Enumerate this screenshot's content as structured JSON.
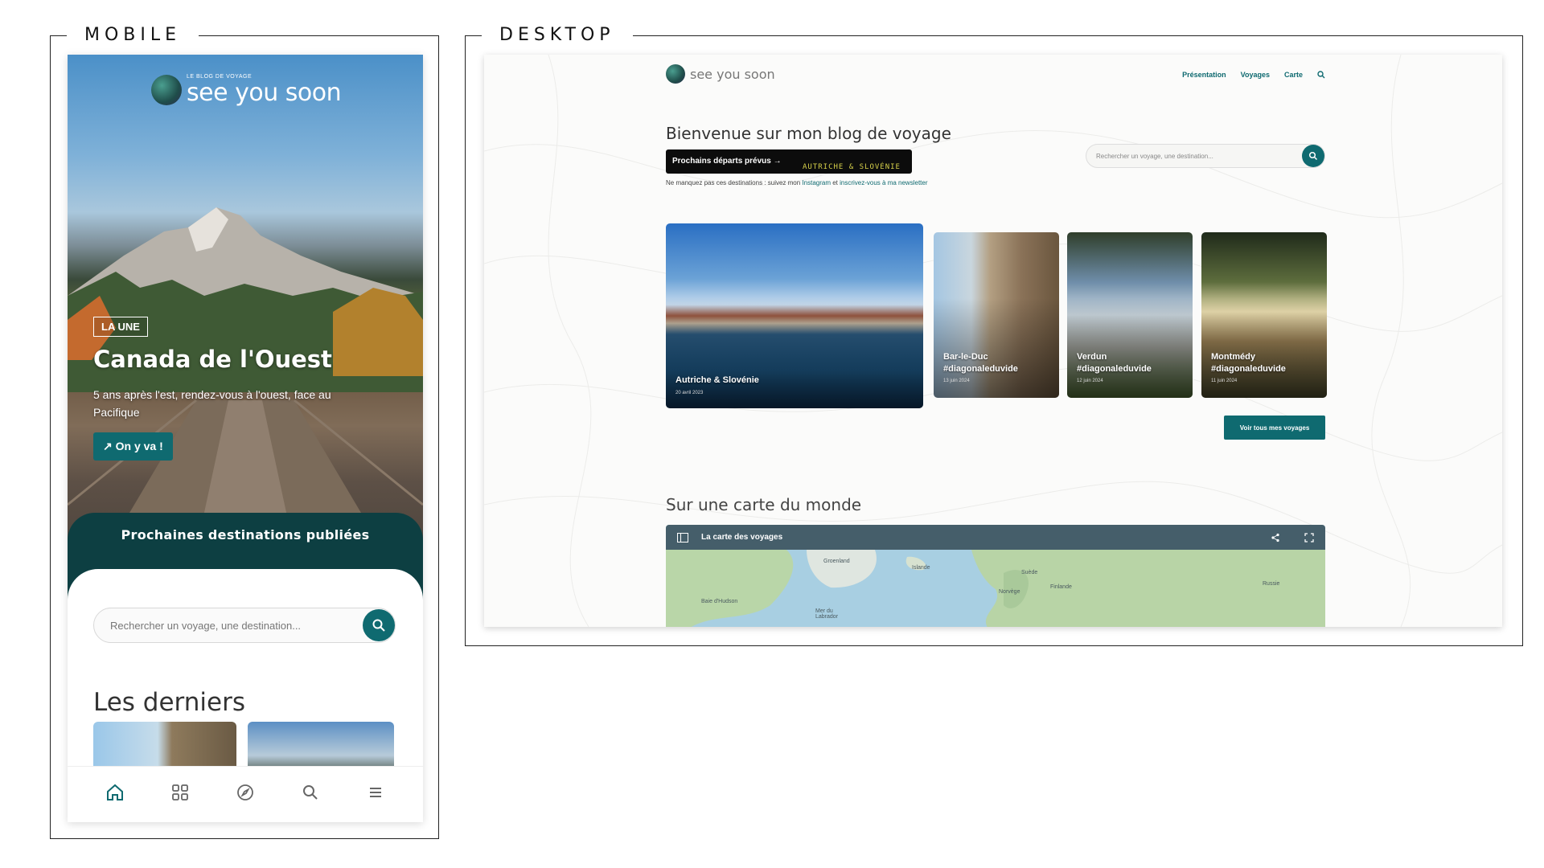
{
  "frames": {
    "mobile": "MOBILE",
    "desktop": "DESKTOP"
  },
  "mobile": {
    "logo_small": "LE BLOG DE VOYAGE",
    "logo_text": "see you soon",
    "badge": "LA UNE",
    "hero_title": "Canada de l'Ouest",
    "hero_subtitle": "5 ans après l'est, rendez-vous à l'ouest, face au Pacifique",
    "cta": "On y va !",
    "next_destinations": "Prochaines destinations publiées",
    "search_placeholder": "Rechercher un voyage, une destination...",
    "latest_title": "Les derniers",
    "tabbar": [
      "home-icon",
      "grid-icon",
      "compass-icon",
      "search-icon",
      "menu-icon"
    ]
  },
  "desktop": {
    "logo_text": "see you soon",
    "nav": [
      "Présentation",
      "Voyages",
      "Carte"
    ],
    "title": "Bienvenue sur mon blog de voyage",
    "departs_label": "Prochains départs prévus →",
    "departs_ticker": "AUTRICHE & SLOVÉNIE",
    "note_prefix": "Ne manquez pas ces destinations : suivez mon ",
    "note_instagram": "Instagram",
    "note_mid": " et ",
    "note_newsletter": "inscrivez-vous à ma newsletter",
    "search_placeholder": "Rechercher un voyage, une destination...",
    "cards": [
      {
        "title": "Autriche & Slovénie",
        "date": "20 avril 2023"
      },
      {
        "title": "Bar-le-Duc #diagonaleduvide",
        "date": "13 juin 2024"
      },
      {
        "title": "Verdun #diagonaleduvide",
        "date": "12 juin 2024"
      },
      {
        "title": "Montmédy #diagonaleduvide",
        "date": "11 juin 2024"
      }
    ],
    "all_trips_button": "Voir tous mes voyages",
    "map_section_title": "Sur une carte du monde",
    "map_bar_title": "La carte des voyages",
    "map_labels": [
      "Groenland",
      "Islande",
      "Suède",
      "Finlande",
      "Norvège",
      "Russie",
      "Baie d'Hudson",
      "Mer du Labrador"
    ]
  },
  "colors": {
    "accent": "#0f6a70",
    "dark_teal": "#0d3f42",
    "map_bar": "#455e6a"
  }
}
